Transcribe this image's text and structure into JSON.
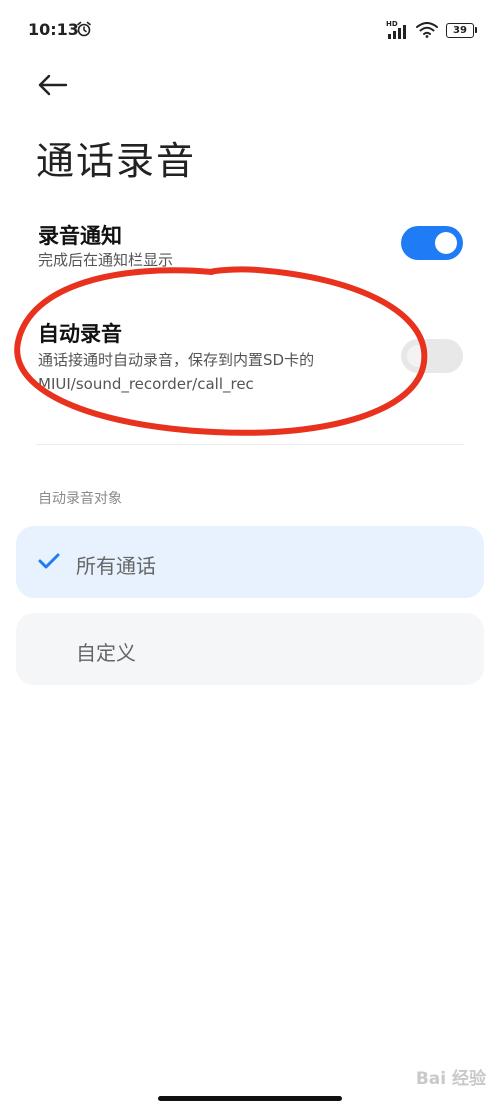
{
  "status_bar": {
    "time": "10:13",
    "hd_label": "HD",
    "battery_level": "39"
  },
  "header": {
    "title": "通话录音"
  },
  "settings": {
    "record_notification": {
      "title": "录音通知",
      "subtitle": "完成后在通知栏显示",
      "enabled": true
    },
    "auto_record": {
      "title": "自动录音",
      "subtitle_line1": "通话接通时自动录音，保存到内置SD卡的",
      "subtitle_line2": "MIUI/sound_recorder/call_rec",
      "enabled": false
    }
  },
  "auto_record_target": {
    "section_label": "自动录音对象",
    "options": [
      {
        "label": "所有通话",
        "selected": true
      },
      {
        "label": "自定义",
        "selected": false
      }
    ]
  },
  "watermark": "Bai 经验",
  "colors": {
    "accent": "#1f7cf4",
    "annotation": "#e8321e",
    "selected_bg": "#e8f2fe"
  }
}
